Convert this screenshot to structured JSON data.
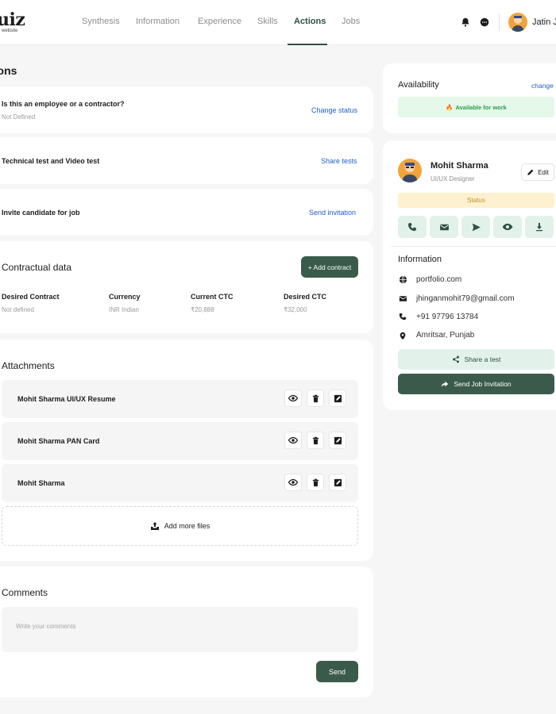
{
  "brand": {
    "logo_text": "uiz",
    "logo_sub": "website"
  },
  "nav": {
    "items": [
      {
        "label": "Synthesis"
      },
      {
        "label": "Information"
      },
      {
        "label": "Experience"
      },
      {
        "label": "Skills"
      },
      {
        "label": "Actions"
      },
      {
        "label": "Jobs"
      }
    ],
    "active": "Actions"
  },
  "header": {
    "user_name": "Jatin J",
    "icons": [
      "bell-icon",
      "chat-icon"
    ]
  },
  "page_title": "tions",
  "questions": [
    {
      "title": "Is this an employee or a contractor?",
      "subtitle": "Not Defined",
      "action": "Change status"
    },
    {
      "title": "Technical test and Video test",
      "action": "Share tests"
    },
    {
      "title": "Invite candidate for job",
      "action": "Send invitation"
    }
  ],
  "contract": {
    "title": "Contractual data",
    "add_label": "+ Add contract",
    "columns": [
      {
        "label": "Desired Contract",
        "value": "Not defined"
      },
      {
        "label": "Currency",
        "value": "INR Indian"
      },
      {
        "label": "Current CTC",
        "value": "₹20,888"
      },
      {
        "label": "Desired CTC",
        "value": "₹32,000"
      }
    ]
  },
  "attachments": {
    "title": "Attachments",
    "files": [
      {
        "name": "Mohit Sharma UI/UX Resume"
      },
      {
        "name": "Mohit Sharma PAN Card"
      },
      {
        "name": "Mohit Sharma"
      }
    ],
    "add_more_label": "Add more files"
  },
  "comments": {
    "title": "Comments",
    "placeholder": "Write your comments",
    "send_label": "Send"
  },
  "availability": {
    "title": "Availability",
    "change_label": "change",
    "badge": "Available for work",
    "badge_emoji": "🔥"
  },
  "profile": {
    "name": "Mohit Sharma",
    "role": "UI/UX Designer",
    "edit_label": "Edit",
    "status_label": "Status",
    "actions": [
      "phone-icon",
      "mail-icon",
      "send-icon",
      "eye-icon",
      "download-icon"
    ]
  },
  "information": {
    "title": "Information",
    "items": [
      {
        "icon": "globe-icon",
        "text": "portfolio.com"
      },
      {
        "icon": "mail-icon",
        "text": "jhinganmohit79@gmail.com"
      },
      {
        "icon": "phone-icon",
        "text": "+91 97796 13784"
      },
      {
        "icon": "location-pin-icon",
        "text": "Amritsar, Punjab"
      }
    ],
    "share_label": "Share a test",
    "invite_label": "Send Job Invitation"
  },
  "colors": {
    "primary": "#3a5b4b",
    "link": "#2360c9",
    "success_bg": "#e5f8ea",
    "success_text": "#2a9d4a",
    "status_bg": "#fdf1cf",
    "status_text": "#c4902a",
    "action_bg": "#e2f2ea"
  }
}
